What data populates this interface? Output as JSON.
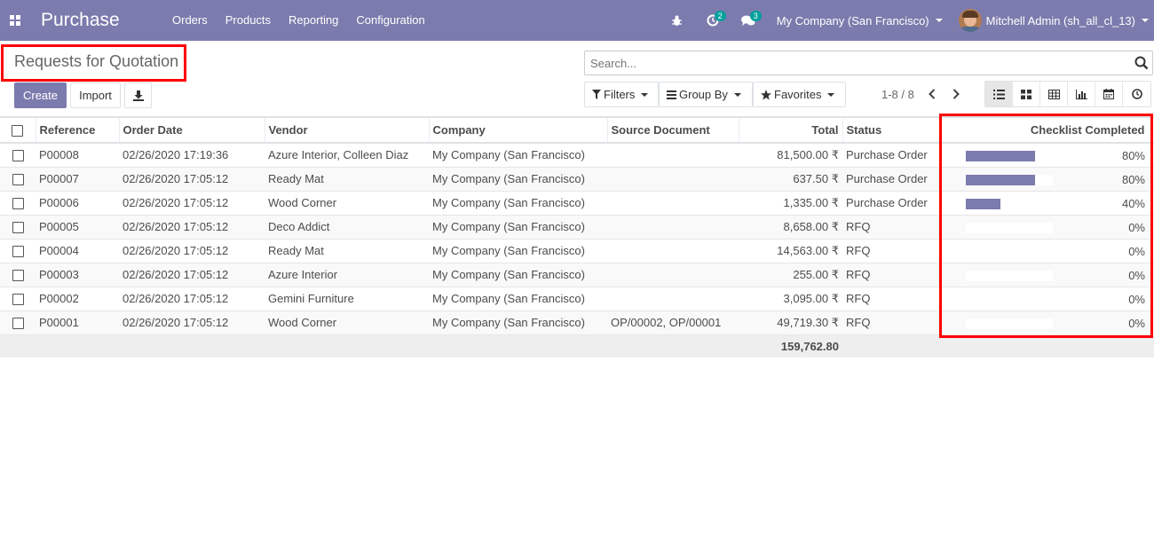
{
  "navbar": {
    "app_title": "Purchase",
    "menu": [
      "Orders",
      "Products",
      "Reporting",
      "Configuration"
    ],
    "activity_count": "2",
    "message_count": "3",
    "company": "My Company (San Francisco)",
    "user": "Mitchell Admin (sh_all_cl_13)",
    "color": "#7c7bad"
  },
  "page": {
    "title": "Requests for Quotation",
    "create_label": "Create",
    "import_label": "Import"
  },
  "search": {
    "placeholder": "Search..."
  },
  "filters": {
    "filters_label": "Filters",
    "groupby_label": "Group By",
    "favorites_label": "Favorites"
  },
  "pager": {
    "text": "1-8 / 8"
  },
  "table": {
    "headers": {
      "reference": "Reference",
      "order_date": "Order Date",
      "vendor": "Vendor",
      "company": "Company",
      "source_document": "Source Document",
      "total": "Total",
      "status": "Status",
      "checklist": "Checklist Completed"
    },
    "rows": [
      {
        "reference": "P00008",
        "order_date": "02/26/2020 17:19:36",
        "vendor": "Azure Interior, Colleen Diaz",
        "company": "My Company (San Francisco)",
        "source_document": "",
        "total": "81,500.00 ₹",
        "status": "Purchase Order",
        "checklist_pct": 80,
        "checklist_label": "80%"
      },
      {
        "reference": "P00007",
        "order_date": "02/26/2020 17:05:12",
        "vendor": "Ready Mat",
        "company": "My Company (San Francisco)",
        "source_document": "",
        "total": "637.50 ₹",
        "status": "Purchase Order",
        "checklist_pct": 80,
        "checklist_label": "80%"
      },
      {
        "reference": "P00006",
        "order_date": "02/26/2020 17:05:12",
        "vendor": "Wood Corner",
        "company": "My Company (San Francisco)",
        "source_document": "",
        "total": "1,335.00 ₹",
        "status": "Purchase Order",
        "checklist_pct": 40,
        "checklist_label": "40%"
      },
      {
        "reference": "P00005",
        "order_date": "02/26/2020 17:05:12",
        "vendor": "Deco Addict",
        "company": "My Company (San Francisco)",
        "source_document": "",
        "total": "8,658.00 ₹",
        "status": "RFQ",
        "checklist_pct": 0,
        "checklist_label": "0%"
      },
      {
        "reference": "P00004",
        "order_date": "02/26/2020 17:05:12",
        "vendor": "Ready Mat",
        "company": "My Company (San Francisco)",
        "source_document": "",
        "total": "14,563.00 ₹",
        "status": "RFQ",
        "checklist_pct": 0,
        "checklist_label": "0%"
      },
      {
        "reference": "P00003",
        "order_date": "02/26/2020 17:05:12",
        "vendor": "Azure Interior",
        "company": "My Company (San Francisco)",
        "source_document": "",
        "total": "255.00 ₹",
        "status": "RFQ",
        "checklist_pct": 0,
        "checklist_label": "0%"
      },
      {
        "reference": "P00002",
        "order_date": "02/26/2020 17:05:12",
        "vendor": "Gemini Furniture",
        "company": "My Company (San Francisco)",
        "source_document": "",
        "total": "3,095.00 ₹",
        "status": "RFQ",
        "checklist_pct": 0,
        "checklist_label": "0%"
      },
      {
        "reference": "P00001",
        "order_date": "02/26/2020 17:05:12",
        "vendor": "Wood Corner",
        "company": "My Company (San Francisco)",
        "source_document": "OP/00002, OP/00001",
        "total": "49,719.30 ₹",
        "status": "RFQ",
        "checklist_pct": 0,
        "checklist_label": "0%"
      }
    ],
    "footer_total": "159,762.80"
  }
}
